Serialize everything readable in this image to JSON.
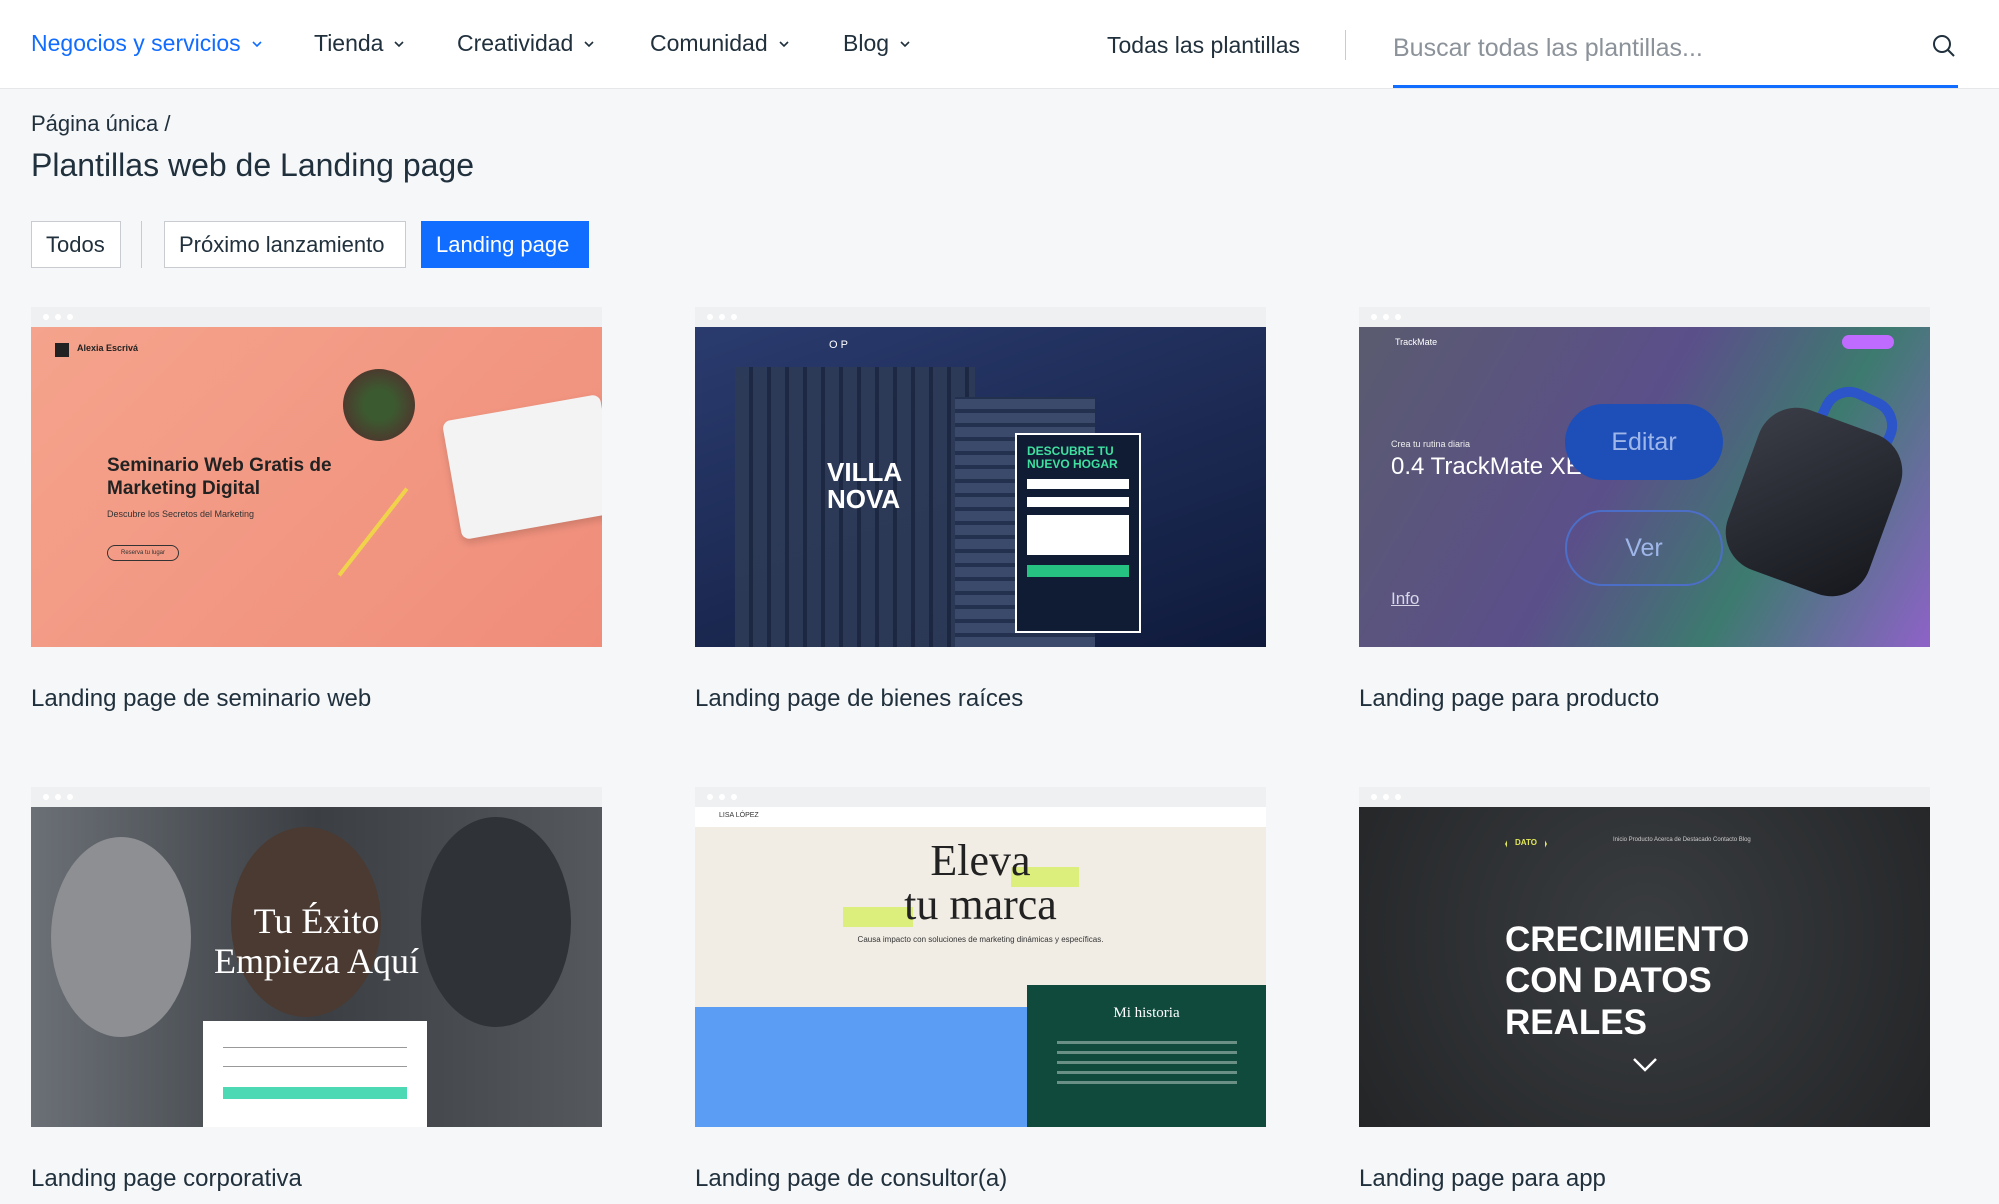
{
  "nav": {
    "items": [
      {
        "label": "Negocios y servicios"
      },
      {
        "label": "Tienda"
      },
      {
        "label": "Creatividad"
      },
      {
        "label": "Comunidad"
      },
      {
        "label": "Blog"
      }
    ],
    "all_templates": "Todas las plantillas",
    "search_placeholder": "Buscar todas las plantillas..."
  },
  "breadcrumb": "Página única  /",
  "page_title": "Plantillas web de Landing page",
  "filters": [
    "Todos",
    "Próximo lanzamiento",
    "Landing page"
  ],
  "colors": {
    "accent": "#116dff",
    "text": "#20303c"
  },
  "cards": [
    {
      "title": "Landing page de seminario web",
      "thumb": {
        "brand": "Alexia Escrivá",
        "heading": "Seminario Web Gratis de Marketing Digital",
        "sub": "Descubre los Secretos del Marketing",
        "button": "Reserva tu lugar"
      }
    },
    {
      "title": "Landing page de bienes raíces",
      "thumb": {
        "logo": "O P",
        "heading_1": "VILLA",
        "heading_2": "NOVA",
        "form_heading": "DESCUBRE TU NUEVO HOGAR"
      }
    },
    {
      "title": "Landing page para producto",
      "thumb": {
        "brand": "TrackMate",
        "sub": "Crea tu rutina diaria",
        "heading": "0.4 TrackMate XE",
        "edit": "Editar",
        "view": "Ver",
        "info": "Info"
      }
    },
    {
      "title": "Landing page corporativa",
      "thumb": {
        "heading_1": "Tu Éxito",
        "heading_2": "Empieza Aquí"
      }
    },
    {
      "title": "Landing page de consultor(a)",
      "thumb": {
        "brand": "LISA LÓPEZ",
        "heading_1": "Eleva",
        "heading_2": "tu marca",
        "sub": "Causa impacto con soluciones de marketing dinámicas y específicas.",
        "story": "Mi historia"
      }
    },
    {
      "title": "Landing page para app",
      "thumb": {
        "logo": "DATO",
        "menu": "Inicio   Producto   Acerca de   Destacado   Contacto   Blog",
        "heading_1": "CRECIMIENTO",
        "heading_2": "CON DATOS",
        "heading_3": "REALES"
      }
    }
  ]
}
